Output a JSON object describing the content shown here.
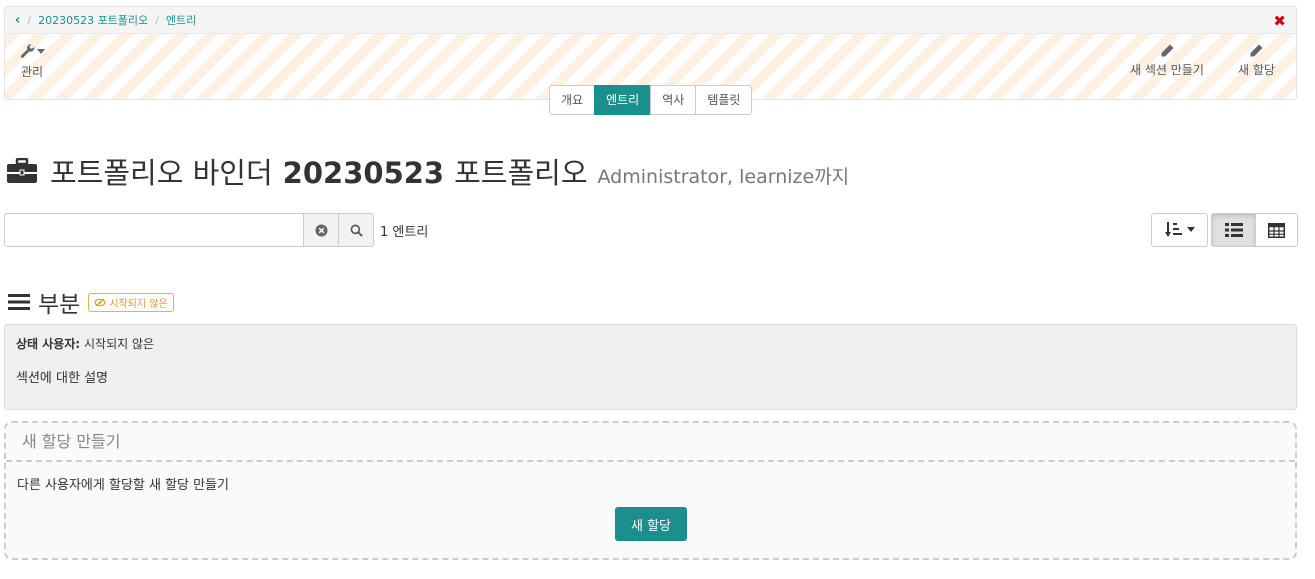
{
  "breadcrumb": {
    "items": [
      "20230523 포트폴리오",
      "엔트리"
    ]
  },
  "toolbar": {
    "manage_label": "관리",
    "new_section_label": "새 섹션 만들기",
    "new_assignment_label": "새 할당"
  },
  "tabs": [
    {
      "label": "개요",
      "active": false
    },
    {
      "label": "엔트리",
      "active": true
    },
    {
      "label": "역사",
      "active": false
    },
    {
      "label": "템플릿",
      "active": false
    }
  ],
  "title": {
    "prefix": "포트폴리오 바인더",
    "name": "20230523",
    "suffix": "포트폴리오",
    "owner": "Administrator, learnize까지"
  },
  "search": {
    "value": "",
    "placeholder": ""
  },
  "entry_count": "1 엔트리",
  "section": {
    "title": "부분",
    "badge": "시작되지 않은",
    "status_label": "상태 사용자:",
    "status_value": "시작되지 않은",
    "description": "섹션에 대한 설명"
  },
  "assignment_box": {
    "header": "새 할당 만들기",
    "description": "다른 사용자에게 할당할 새 할당 만들기",
    "button_label": "새 할당"
  },
  "colors": {
    "accent": "#1a8f8c",
    "close": "#d0021b",
    "badge": "#f0ad4e"
  }
}
